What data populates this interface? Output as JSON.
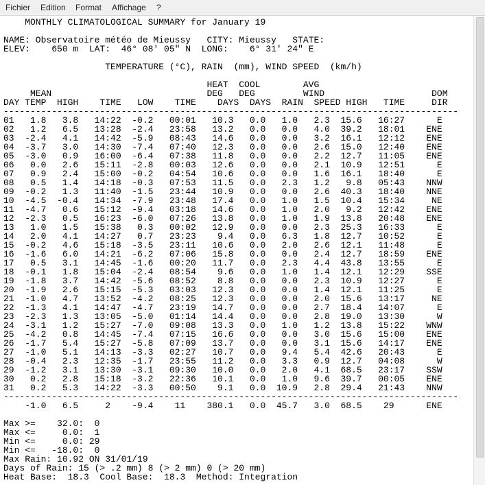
{
  "menu": [
    "Fichier",
    "Edition",
    "Format",
    "Affichage",
    "?"
  ],
  "lines": [
    "    MONTHLY CLIMATOLOGICAL SUMMARY for January 19",
    "",
    "NAME: Observatoire météo de Mieussy   CITY: Mieussy   STATE:",
    "ELEV:    650 m  LAT:  46° 08' 05\" N  LONG:    6° 31' 24\" E",
    "",
    "                   TEMPERATURE (°C), RAIN  (mm), WIND SPEED  (km/h)",
    "",
    "                                      HEAT  COOL        AVG",
    "     MEAN                             DEG   DEG         WIND                    DOM",
    "DAY TEMP  HIGH    TIME   LOW    TIME    DAYS  DAYS  RAIN  SPEED HIGH   TIME     DIR",
    "-------------------------------------------------------------------------------------",
    "01   1.8   3.8   14:22  -0.2   00:01   10.3   0.0   1.0   2.3  15.6   16:27      E",
    "02   1.2   6.5   13:28  -2.4   23:58   13.2   0.0   0.0   4.0  39.2   18:01    ENE",
    "03  -2.4   4.1   14:42  -5.9   08:43   14.6   0.0   0.0   3.2  16.1   12:12    ENE",
    "04  -3.7   3.0   14:30  -7.4   07:40   12.3   0.0   0.0   2.6  15.0   12:40    ENE",
    "05  -3.0   0.9   16:00  -6.4   07:38   11.8   0.0   0.0   2.2  12.7   11:05    ENE",
    "06   0.0   2.6   15:11  -2.8   00:03   12.6   0.0   0.0   2.1  10.9   12:51      E",
    "07   0.9   2.4   15:00  -0.2   04:54   10.6   0.0   0.0   1.6  16.1   18:40      E",
    "08   0.5   1.4   14:18  -0.3   07:53   11.5   0.0   2.3   1.2   9.8   05:43    NNW",
    "09  -0.2   1.3   11:40  -1.5   23:44   10.9   0.0   0.0   2.6  40.3   18:40    NNE",
    "10  -4.5  -0.4   14:34  -7.9   23:48   17.4   0.0   1.0   1.5  10.4   15:34     NE",
    "11  -4.7   0.6   15:12  -9.4   03:18   14.6   0.0   1.0   2.0   9.2   12:42    ENE",
    "12  -2.3   0.5   16:23  -6.0   07:26   13.8   0.0   1.0   1.9  13.8   20:48    ENE",
    "13   1.0   1.5   15:38   0.3   00:02   12.9   0.0   0.0   2.3  25.3   16:33      E",
    "14   2.0   4.1   14:27   0.7   23:23    9.4   0.0   6.3   1.8  12.7   10:52      E",
    "15  -0.2   4.6   15:18  -3.5   23:11   10.6   0.0   2.0   2.6  12.1   11:48      E",
    "16  -1.6   6.0   14:21  -6.2   07:06   15.8   0.0   0.0   2.4  12.7   18:59    ENE",
    "17   0.5   3.1   14:45  -1.6   00:20   11.7   0.0   2.3   4.4  43.8   13:55      E",
    "18  -0.1   1.8   15:04  -2.4   08:54    9.6   0.0   1.0   1.4  12.1   12:29    SSE",
    "19  -1.8   3.7   14:42  -5.6   08:52    8.8   0.0   0.0   2.3  10.9   12:27      E",
    "20  -1.9   2.6   15:15  -5.3   03:03   12.3   0.0   0.0   1.4  12.1   11:25      E",
    "21  -1.0   4.7   13:52  -4.2   08:25   12.3   0.0   0.0   2.0  15.6   13:17     NE",
    "22  -1.3   4.1   14:47  -4.7   23:19   14.7   0.0   0.0   2.7  18.4   14:07      E",
    "23  -2.3   1.3   13:05  -5.0   01:14   14.4   0.0   0.0   2.8  19.0   13:30      W",
    "24  -3.1   1.2   15:27  -7.0   09:08   13.3   0.0   1.0   1.2  13.8   15:22    WNW",
    "25  -4.2   0.8   14:45  -7.4   07:15   16.6   0.0   0.0   3.0  15.6   15:00    ENE",
    "26  -1.7   5.4   15:27  -5.8   07:09   13.7   0.0   0.0   3.1  15.6   14:17    ENE",
    "27  -1.0   5.1   14:13  -3.3   02:27   10.7   0.0   9.4   5.4  42.6   20:43      E",
    "28  -0.4   2.3   12:35  -1.7   23:55   11.2   0.0   3.3   0.9  12.7   04:08      W",
    "29  -1.2   3.1   13:30  -3.1   09:30   10.0   0.0   2.0   4.1  68.5   23:17    SSW",
    "30   0.2   2.8   15:18  -3.2   22:36   10.1   0.0   1.0   9.6  39.7   00:05    ENE",
    "31   0.2   5.3   14:22  -3.3   00:50    9.1   0.0  10.9   2.8  29.4   21:43    NNW",
    "-------------------------------------------------------------------------------------",
    "    -1.0   6.5     2    -9.4    11    380.1   0.0  45.7   3.0  68.5    29      ENE",
    "",
    "Max >=    32.0:  0",
    "Max <=     0.0:  1",
    "Min <=     0.0: 29",
    "Min <=   -18.0:  0",
    "Max Rain: 10.92 ON 31/01/19",
    "Days of Rain: 15 (> .2 mm) 8 (> 2 mm) 0 (> 20 mm)",
    "Heat Base:  18.3  Cool Base:  18.3  Method: Integration"
  ]
}
